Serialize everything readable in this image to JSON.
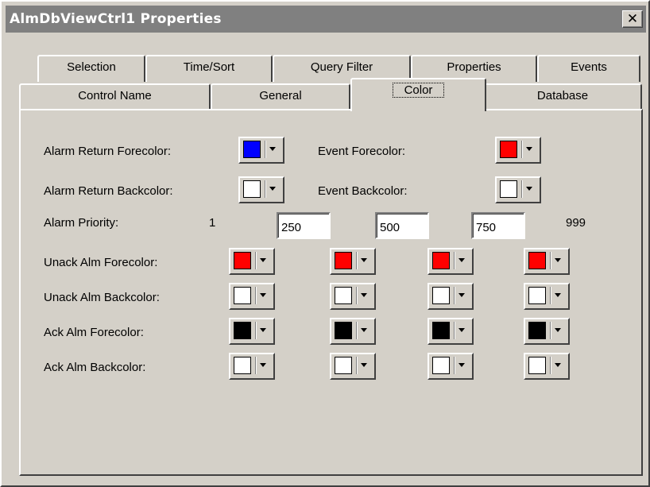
{
  "window": {
    "title": "AlmDbViewCtrl1 Properties",
    "close_glyph": "✕"
  },
  "tabs_back": [
    "Selection",
    "Time/Sort",
    "Query Filter",
    "Properties",
    "Events"
  ],
  "tabs_front": [
    "Control Name",
    "General",
    "Color",
    "Database"
  ],
  "active_tab": "Color",
  "labels": {
    "alarm_return_fore": "Alarm Return Forecolor:",
    "alarm_return_back": "Alarm Return Backcolor:",
    "event_fore": "Event Forecolor:",
    "event_back": "Event Backcolor:",
    "alarm_priority": "Alarm Priority:",
    "unack_fore": "Unack Alm Forecolor:",
    "unack_back": "Unack Alm Backcolor:",
    "ack_fore": "Ack Alm Forecolor:",
    "ack_back": "Ack Alm Backcolor:"
  },
  "priority": {
    "min": "1",
    "t1": "250",
    "t2": "500",
    "t3": "750",
    "max": "999"
  },
  "colors": {
    "alarm_return_fore": "#0000ff",
    "alarm_return_back": "#ffffff",
    "event_fore": "#ff0000",
    "event_back": "#ffffff",
    "unack_fore": [
      "#ff0000",
      "#ff0000",
      "#ff0000",
      "#ff0000"
    ],
    "unack_back": [
      "#ffffff",
      "#ffffff",
      "#ffffff",
      "#ffffff"
    ],
    "ack_fore": [
      "#000000",
      "#000000",
      "#000000",
      "#000000"
    ],
    "ack_back": [
      "#ffffff",
      "#ffffff",
      "#ffffff",
      "#ffffff"
    ]
  }
}
